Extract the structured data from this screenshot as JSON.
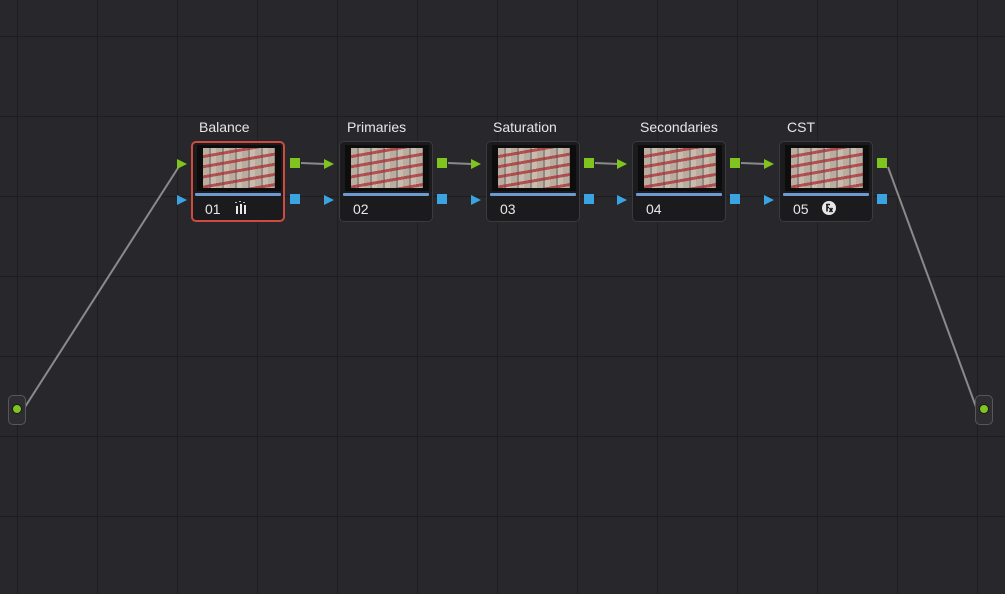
{
  "node_graph": {
    "nodes": [
      {
        "label": "Balance",
        "number": "01",
        "badge_icon": "bars-icon",
        "selected": true
      },
      {
        "label": "Primaries",
        "number": "02",
        "badge_icon": "",
        "selected": false
      },
      {
        "label": "Saturation",
        "number": "03",
        "badge_icon": "",
        "selected": false
      },
      {
        "label": "Secondaries",
        "number": "04",
        "badge_icon": "",
        "selected": false
      },
      {
        "label": "CST",
        "number": "05",
        "badge_icon": "fx-icon",
        "selected": false
      }
    ],
    "colors": {
      "background": "#28282c",
      "grid": "#1e1e21",
      "node_body": "#1b1b1e",
      "selected_outline": "#cf4b40",
      "rgb_port": "#7fc41f",
      "alpha_port": "#3aa3e0",
      "link": "#8a8a8a"
    },
    "terminals": {
      "input_icon": "source-input-icon",
      "output_icon": "node-output-icon"
    }
  }
}
